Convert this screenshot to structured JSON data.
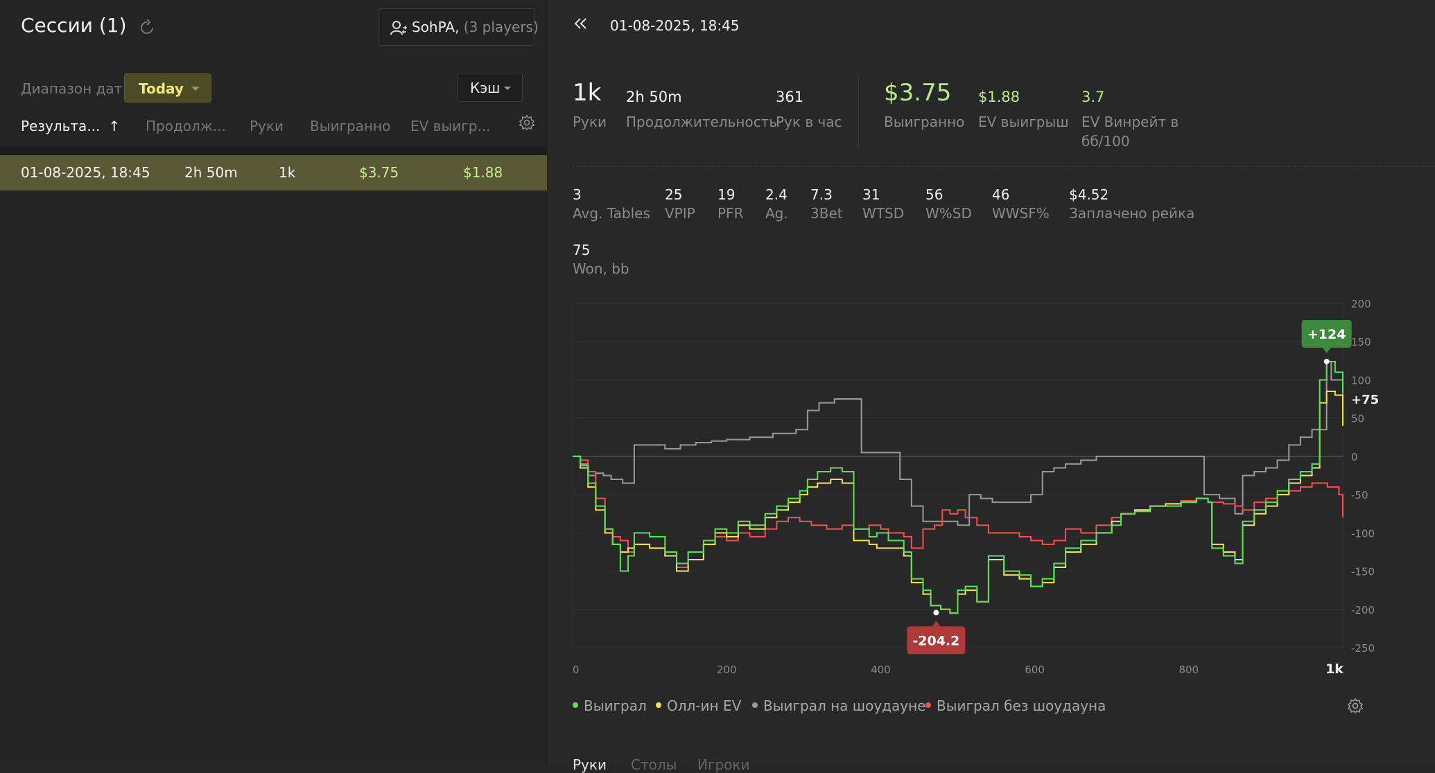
{
  "sessions": {
    "title": "Сессии (1)",
    "player_name": "SohPA,",
    "player_count": " (3 players)",
    "date_range_label": "Диапазон дат",
    "date_range_value": "Today",
    "game_type": "Кэш",
    "columns": [
      "Результа...",
      "Продолж...",
      "Руки",
      "Выигранно",
      "EV выигр..."
    ],
    "rows": [
      {
        "date": "01-08-2025, 18:45",
        "duration": "2h 50m",
        "hands": "1k",
        "won": "$3.75",
        "ev_won": "$1.88"
      }
    ]
  },
  "detail": {
    "date": "01-08-2025, 18:45",
    "stats_top": [
      {
        "value": "1k",
        "label": "Руки"
      },
      {
        "value": "2h 50m",
        "label": "Продолжительность"
      },
      {
        "value": "361",
        "label": "Рук в час"
      },
      {
        "value": "$3.75",
        "label": "Выигранно"
      },
      {
        "value": "$1.88",
        "label": "EV выигрыш"
      },
      {
        "value": "3.7",
        "label": "EV Винрейт в",
        "label2": "бб/100"
      }
    ],
    "stats_row2": [
      {
        "value": "3",
        "label": "Avg. Tables"
      },
      {
        "value": "25",
        "label": "VPIP"
      },
      {
        "value": "19",
        "label": "PFR"
      },
      {
        "value": "2.4",
        "label": "Ag."
      },
      {
        "value": "7.3",
        "label": "3Bet"
      },
      {
        "value": "31",
        "label": "WTSD"
      },
      {
        "value": "56",
        "label": "W%SD"
      },
      {
        "value": "46",
        "label": "WWSF%"
      },
      {
        "value": "$4.52",
        "label": "Заплачено рейка"
      }
    ],
    "stats_row3": [
      {
        "value": "75",
        "label": "Won, bb"
      }
    ],
    "tabs": [
      "Руки",
      "Столы",
      "Игроки"
    ]
  },
  "colors": {
    "won": "#5fe05a",
    "allin_ev": "#f2e35b",
    "showdown": "#9a9a9a",
    "non_showdown": "#ef5350",
    "max_badge": "#3d8a3d",
    "min_badge": "#b03a3a"
  },
  "chart_data": {
    "type": "line",
    "xlabel": "",
    "ylabel": "",
    "xlim": [
      0,
      1000
    ],
    "ylim": [
      -250,
      200
    ],
    "x_ticks": [
      "0",
      "200",
      "400",
      "600",
      "800",
      "1k"
    ],
    "y_ticks": [
      "200",
      "150",
      "100",
      "50",
      "0",
      "-50",
      "-100",
      "-150",
      "-200",
      "-250"
    ],
    "max_label": "+124",
    "max_point": [
      979,
      124
    ],
    "min_label": "-204.2",
    "min_point": [
      472,
      -204.2
    ],
    "end_label": "+75",
    "legend": [
      "Выиграл",
      "Олл-ин EV",
      "Выиграл на шоудауне",
      "Выиграл без шоудауна"
    ],
    "series": [
      {
        "name": "Выиграл",
        "color": "#5fe05a",
        "points": [
          [
            0,
            0
          ],
          [
            10,
            -12
          ],
          [
            20,
            -35
          ],
          [
            30,
            -65
          ],
          [
            42,
            -95
          ],
          [
            52,
            -115
          ],
          [
            62,
            -150
          ],
          [
            72,
            -130
          ],
          [
            80,
            -100
          ],
          [
            100,
            -105
          ],
          [
            120,
            -125
          ],
          [
            135,
            -140
          ],
          [
            150,
            -125
          ],
          [
            170,
            -110
          ],
          [
            185,
            -95
          ],
          [
            200,
            -100
          ],
          [
            215,
            -85
          ],
          [
            230,
            -90
          ],
          [
            250,
            -75
          ],
          [
            265,
            -65
          ],
          [
            280,
            -55
          ],
          [
            295,
            -45
          ],
          [
            305,
            -30
          ],
          [
            318,
            -20
          ],
          [
            335,
            -15
          ],
          [
            350,
            -20
          ],
          [
            365,
            -95
          ],
          [
            385,
            -105
          ],
          [
            395,
            -100
          ],
          [
            410,
            -110
          ],
          [
            430,
            -125
          ],
          [
            440,
            -160
          ],
          [
            455,
            -175
          ],
          [
            465,
            -195
          ],
          [
            478,
            -200
          ],
          [
            490,
            -205
          ],
          [
            500,
            -175
          ],
          [
            510,
            -170
          ],
          [
            525,
            -190
          ],
          [
            540,
            -130
          ],
          [
            560,
            -150
          ],
          [
            580,
            -155
          ],
          [
            595,
            -170
          ],
          [
            610,
            -160
          ],
          [
            625,
            -140
          ],
          [
            640,
            -120
          ],
          [
            660,
            -110
          ],
          [
            680,
            -100
          ],
          [
            700,
            -90
          ],
          [
            712,
            -75
          ],
          [
            730,
            -72
          ],
          [
            750,
            -65
          ],
          [
            770,
            -65
          ],
          [
            790,
            -60
          ],
          [
            810,
            -55
          ],
          [
            825,
            -60
          ],
          [
            830,
            -120
          ],
          [
            845,
            -130
          ],
          [
            860,
            -140
          ],
          [
            870,
            -85
          ],
          [
            885,
            -70
          ],
          [
            900,
            -60
          ],
          [
            915,
            -45
          ],
          [
            930,
            -30
          ],
          [
            945,
            -20
          ],
          [
            960,
            -10
          ],
          [
            970,
            100
          ],
          [
            979,
            124
          ],
          [
            990,
            110
          ],
          [
            1000,
            85
          ]
        ]
      },
      {
        "name": "Олл-ин EV",
        "color": "#f2e35b",
        "points": [
          [
            0,
            0
          ],
          [
            10,
            -15
          ],
          [
            20,
            -40
          ],
          [
            30,
            -70
          ],
          [
            42,
            -100
          ],
          [
            52,
            -115
          ],
          [
            62,
            -125
          ],
          [
            72,
            -120
          ],
          [
            80,
            -115
          ],
          [
            100,
            -120
          ],
          [
            120,
            -130
          ],
          [
            135,
            -150
          ],
          [
            150,
            -135
          ],
          [
            170,
            -115
          ],
          [
            185,
            -100
          ],
          [
            200,
            -105
          ],
          [
            215,
            -90
          ],
          [
            230,
            -95
          ],
          [
            250,
            -80
          ],
          [
            265,
            -70
          ],
          [
            280,
            -60
          ],
          [
            295,
            -50
          ],
          [
            305,
            -40
          ],
          [
            318,
            -35
          ],
          [
            335,
            -30
          ],
          [
            350,
            -35
          ],
          [
            365,
            -110
          ],
          [
            385,
            -115
          ],
          [
            395,
            -120
          ],
          [
            410,
            -120
          ],
          [
            430,
            -130
          ],
          [
            440,
            -165
          ],
          [
            455,
            -180
          ],
          [
            465,
            -195
          ],
          [
            478,
            -200
          ],
          [
            490,
            -205
          ],
          [
            500,
            -180
          ],
          [
            510,
            -175
          ],
          [
            525,
            -190
          ],
          [
            540,
            -135
          ],
          [
            560,
            -155
          ],
          [
            580,
            -160
          ],
          [
            595,
            -170
          ],
          [
            610,
            -165
          ],
          [
            625,
            -145
          ],
          [
            640,
            -125
          ],
          [
            660,
            -115
          ],
          [
            680,
            -100
          ],
          [
            700,
            -85
          ],
          [
            712,
            -75
          ],
          [
            730,
            -70
          ],
          [
            750,
            -65
          ],
          [
            770,
            -62
          ],
          [
            790,
            -60
          ],
          [
            810,
            -55
          ],
          [
            825,
            -60
          ],
          [
            830,
            -115
          ],
          [
            845,
            -125
          ],
          [
            860,
            -135
          ],
          [
            870,
            -90
          ],
          [
            885,
            -75
          ],
          [
            900,
            -65
          ],
          [
            915,
            -50
          ],
          [
            930,
            -35
          ],
          [
            945,
            -25
          ],
          [
            960,
            -15
          ],
          [
            970,
            70
          ],
          [
            979,
            85
          ],
          [
            990,
            80
          ],
          [
            1000,
            40
          ]
        ]
      },
      {
        "name": "Выиграл на шоудауне",
        "color": "#9a9a9a",
        "points": [
          [
            0,
            0
          ],
          [
            10,
            -10
          ],
          [
            20,
            -25
          ],
          [
            30,
            -22
          ],
          [
            40,
            -25
          ],
          [
            50,
            -30
          ],
          [
            65,
            -35
          ],
          [
            80,
            15
          ],
          [
            100,
            15
          ],
          [
            120,
            10
          ],
          [
            140,
            15
          ],
          [
            160,
            18
          ],
          [
            180,
            20
          ],
          [
            200,
            22
          ],
          [
            230,
            25
          ],
          [
            260,
            30
          ],
          [
            290,
            35
          ],
          [
            305,
            60
          ],
          [
            320,
            70
          ],
          [
            340,
            75
          ],
          [
            365,
            75
          ],
          [
            375,
            5
          ],
          [
            395,
            5
          ],
          [
            410,
            5
          ],
          [
            425,
            -30
          ],
          [
            440,
            -65
          ],
          [
            455,
            -85
          ],
          [
            470,
            -85
          ],
          [
            490,
            -85
          ],
          [
            500,
            -90
          ],
          [
            515,
            -50
          ],
          [
            530,
            -55
          ],
          [
            545,
            -60
          ],
          [
            565,
            -60
          ],
          [
            595,
            -50
          ],
          [
            610,
            -20
          ],
          [
            625,
            -15
          ],
          [
            640,
            -10
          ],
          [
            660,
            -5
          ],
          [
            680,
            0
          ],
          [
            700,
            0
          ],
          [
            720,
            0
          ],
          [
            740,
            0
          ],
          [
            760,
            0
          ],
          [
            780,
            0
          ],
          [
            810,
            0
          ],
          [
            820,
            -50
          ],
          [
            840,
            -55
          ],
          [
            860,
            -75
          ],
          [
            870,
            -25
          ],
          [
            885,
            -20
          ],
          [
            900,
            -15
          ],
          [
            915,
            -5
          ],
          [
            930,
            15
          ],
          [
            945,
            25
          ],
          [
            960,
            35
          ],
          [
            979,
            124
          ],
          [
            985,
            100
          ],
          [
            1000,
            80
          ]
        ]
      },
      {
        "name": "Выиграл без шоудауна",
        "color": "#ef5350",
        "points": [
          [
            0,
            0
          ],
          [
            10,
            -5
          ],
          [
            20,
            -20
          ],
          [
            30,
            -55
          ],
          [
            42,
            -95
          ],
          [
            52,
            -105
          ],
          [
            62,
            -110
          ],
          [
            72,
            -125
          ],
          [
            80,
            -115
          ],
          [
            100,
            -120
          ],
          [
            120,
            -130
          ],
          [
            135,
            -145
          ],
          [
            150,
            -135
          ],
          [
            170,
            -115
          ],
          [
            185,
            -105
          ],
          [
            200,
            -110
          ],
          [
            215,
            -100
          ],
          [
            230,
            -105
          ],
          [
            250,
            -95
          ],
          [
            265,
            -85
          ],
          [
            280,
            -80
          ],
          [
            295,
            -85
          ],
          [
            310,
            -90
          ],
          [
            330,
            -95
          ],
          [
            350,
            -90
          ],
          [
            365,
            -95
          ],
          [
            385,
            -90
          ],
          [
            400,
            -95
          ],
          [
            410,
            -100
          ],
          [
            430,
            -105
          ],
          [
            440,
            -120
          ],
          [
            455,
            -95
          ],
          [
            470,
            -90
          ],
          [
            480,
            -70
          ],
          [
            490,
            -75
          ],
          [
            500,
            -70
          ],
          [
            510,
            -80
          ],
          [
            525,
            -90
          ],
          [
            540,
            -100
          ],
          [
            560,
            -100
          ],
          [
            580,
            -105
          ],
          [
            595,
            -110
          ],
          [
            610,
            -115
          ],
          [
            625,
            -110
          ],
          [
            640,
            -95
          ],
          [
            660,
            -100
          ],
          [
            680,
            -90
          ],
          [
            700,
            -80
          ],
          [
            712,
            -75
          ],
          [
            730,
            -70
          ],
          [
            750,
            -65
          ],
          [
            770,
            -62
          ],
          [
            790,
            -58
          ],
          [
            810,
            -55
          ],
          [
            825,
            -60
          ],
          [
            830,
            -60
          ],
          [
            845,
            -62
          ],
          [
            860,
            -65
          ],
          [
            870,
            -70
          ],
          [
            885,
            -60
          ],
          [
            900,
            -55
          ],
          [
            915,
            -50
          ],
          [
            930,
            -45
          ],
          [
            945,
            -40
          ],
          [
            960,
            -35
          ],
          [
            980,
            -40
          ],
          [
            995,
            -50
          ],
          [
            1000,
            -80
          ]
        ]
      }
    ]
  }
}
